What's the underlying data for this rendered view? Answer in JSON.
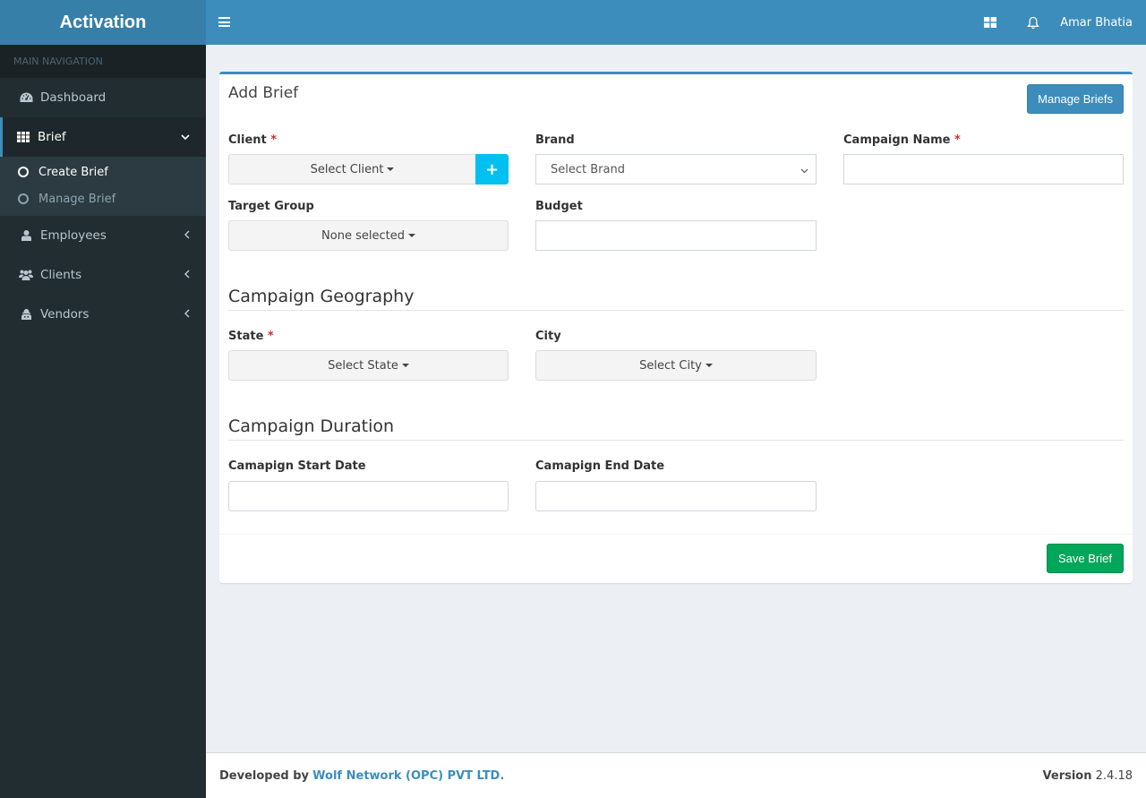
{
  "app": {
    "title": "Activation"
  },
  "navbar": {
    "toggle_icon": "hamburger-icon",
    "apps_icon": "grid-icon",
    "notifications_icon": "bell-icon",
    "user_name": "Amar Bhatia"
  },
  "sidebar": {
    "header": "MAIN NAVIGATION",
    "items": [
      {
        "label": "Dashboard",
        "icon": "dashboard-icon",
        "arrow": ""
      },
      {
        "label": "Brief",
        "icon": "th-grid-icon",
        "arrow": "chevron-down-icon",
        "active": true,
        "children": [
          {
            "label": "Create Brief",
            "active": true
          },
          {
            "label": "Manage Brief",
            "active": false
          }
        ]
      },
      {
        "label": "Employees",
        "icon": "user-icon",
        "arrow": "chevron-left-icon"
      },
      {
        "label": "Clients",
        "icon": "users-icon",
        "arrow": "chevron-left-icon"
      },
      {
        "label": "Vendors",
        "icon": "vendor-icon",
        "arrow": "chevron-left-icon"
      }
    ]
  },
  "form": {
    "title": "Add Brief",
    "manage_button": "Manage Briefs",
    "client": {
      "label": "Client",
      "required": "*",
      "value": "Select Client"
    },
    "brand": {
      "label": "Brand",
      "value": "Select Brand"
    },
    "campaign_name": {
      "label": "Campaign Name",
      "required": "*",
      "value": ""
    },
    "target_group": {
      "label": "Target Group",
      "value": "None selected"
    },
    "budget": {
      "label": "Budget",
      "value": ""
    },
    "geography_title": "Campaign Geography",
    "state": {
      "label": "State",
      "required": "*",
      "value": "Select State"
    },
    "city": {
      "label": "City",
      "value": "Select City"
    },
    "duration_title": "Campaign Duration",
    "start_date": {
      "label": "Camapign Start Date",
      "value": ""
    },
    "end_date": {
      "label": "Camapign End Date",
      "value": ""
    },
    "save_button": "Save Brief"
  },
  "footer": {
    "developed_by": "Developed by",
    "company": "Wolf Network (OPC) PVT LTD.",
    "version_label": "Version",
    "version": "2.4.18"
  },
  "colors": {
    "primary": "#3c8dbc",
    "logo_bg": "#367fa9",
    "sidebar_bg": "#222d32",
    "success": "#00a65a",
    "info": "#00c0ef",
    "required": "#c9302c"
  }
}
